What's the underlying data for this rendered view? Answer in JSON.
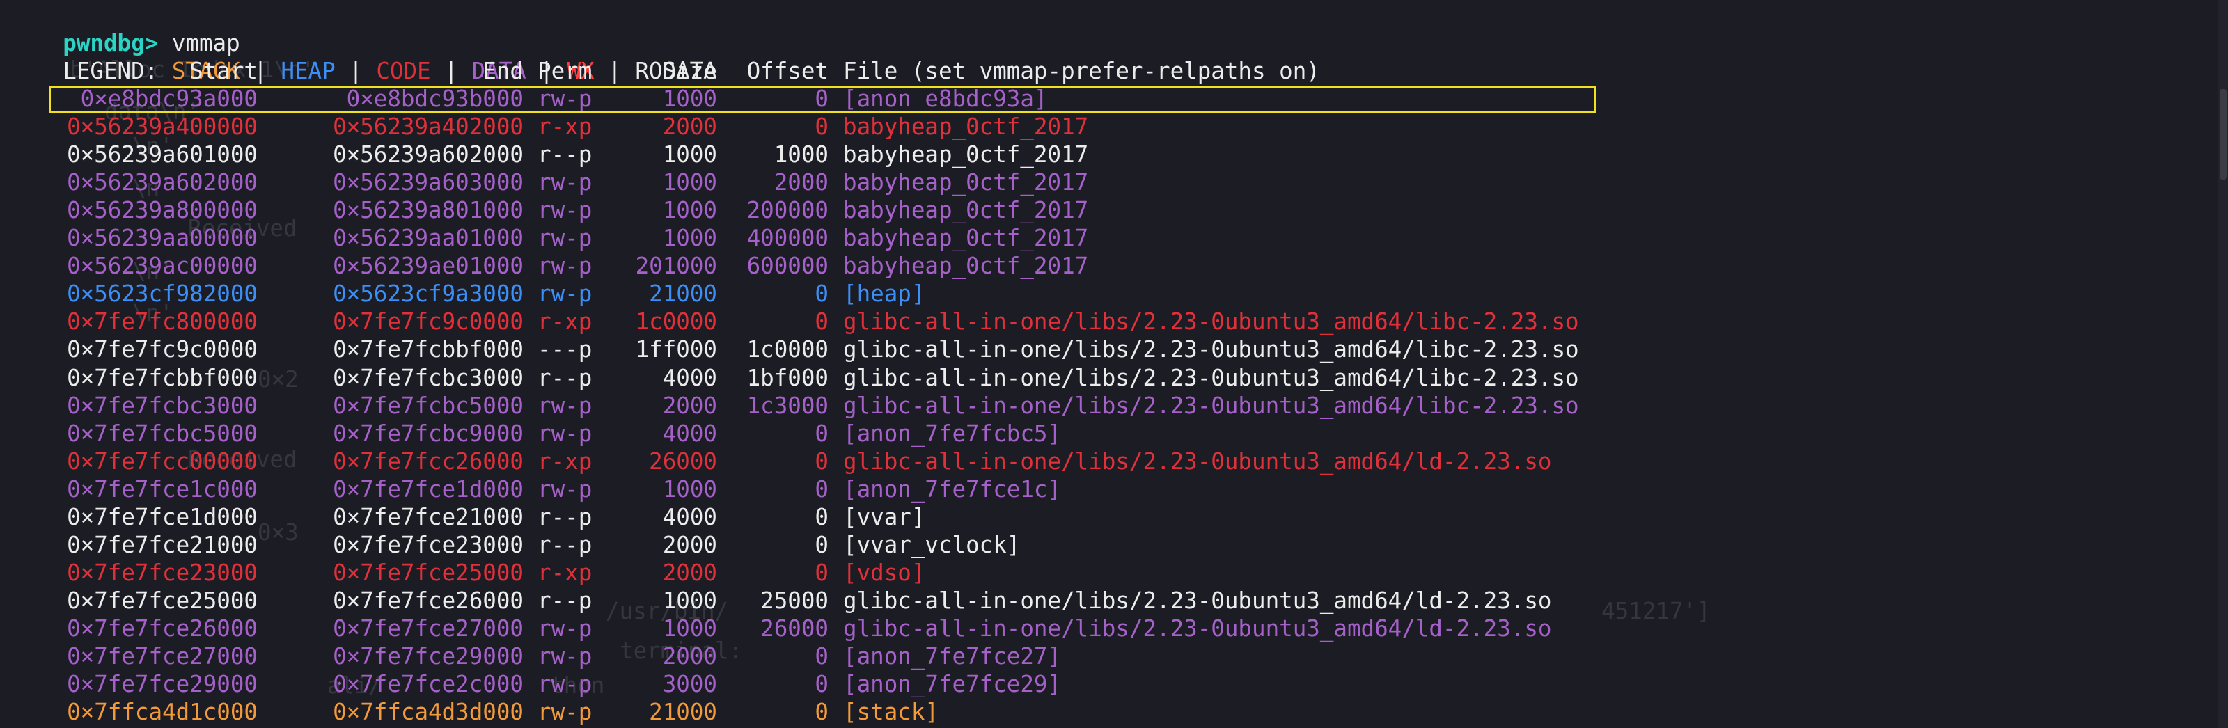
{
  "prompt": {
    "label": "pwndbg>",
    "command": "vmmap"
  },
  "legend": {
    "label": "LEGEND:",
    "separator": "|",
    "items": [
      {
        "text": "STACK",
        "color": "#f39a3a"
      },
      {
        "text": "HEAP",
        "color": "#3b8ff6"
      },
      {
        "text": "CODE",
        "color": "#e0303a"
      },
      {
        "text": "DATA",
        "color": "#a561c9"
      },
      {
        "text": "WX",
        "color": "#ff3d3d"
      },
      {
        "text": "RODATA",
        "color": "#ececec"
      }
    ]
  },
  "table": {
    "headers": {
      "start": "Start",
      "end": "End",
      "perm": "Perm",
      "size": "Size",
      "offset": "Offset",
      "file": "File (set vmmap-prefer-relpaths on)"
    },
    "rows": [
      {
        "start": "0×e8bdc93a000",
        "end": "0×e8bdc93b000",
        "perm": "rw-p",
        "size": "1000",
        "offset": "0",
        "file": "[anon_e8bdc93a]",
        "kind": "data",
        "highlighted": true
      },
      {
        "start": "0×56239a400000",
        "end": "0×56239a402000",
        "perm": "r-xp",
        "size": "2000",
        "offset": "0",
        "file": "babyheap_0ctf_2017",
        "kind": "code"
      },
      {
        "start": "0×56239a601000",
        "end": "0×56239a602000",
        "perm": "r--p",
        "size": "1000",
        "offset": "1000",
        "file": "babyheap_0ctf_2017",
        "kind": "rodata"
      },
      {
        "start": "0×56239a602000",
        "end": "0×56239a603000",
        "perm": "rw-p",
        "size": "1000",
        "offset": "2000",
        "file": "babyheap_0ctf_2017",
        "kind": "data"
      },
      {
        "start": "0×56239a800000",
        "end": "0×56239a801000",
        "perm": "rw-p",
        "size": "1000",
        "offset": "200000",
        "file": "babyheap_0ctf_2017",
        "kind": "data"
      },
      {
        "start": "0×56239aa00000",
        "end": "0×56239aa01000",
        "perm": "rw-p",
        "size": "1000",
        "offset": "400000",
        "file": "babyheap_0ctf_2017",
        "kind": "data"
      },
      {
        "start": "0×56239ac00000",
        "end": "0×56239ae01000",
        "perm": "rw-p",
        "size": "201000",
        "offset": "600000",
        "file": "babyheap_0ctf_2017",
        "kind": "data"
      },
      {
        "start": "0×5623cf982000",
        "end": "0×5623cf9a3000",
        "perm": "rw-p",
        "size": "21000",
        "offset": "0",
        "file": "[heap]",
        "kind": "heap"
      },
      {
        "start": "0×7fe7fc800000",
        "end": "0×7fe7fc9c0000",
        "perm": "r-xp",
        "size": "1c0000",
        "offset": "0",
        "file": "glibc-all-in-one/libs/2.23-0ubuntu3_amd64/libc-2.23.so",
        "kind": "code"
      },
      {
        "start": "0×7fe7fc9c0000",
        "end": "0×7fe7fcbbf000",
        "perm": "---p",
        "size": "1ff000",
        "offset": "1c0000",
        "file": "glibc-all-in-one/libs/2.23-0ubuntu3_amd64/libc-2.23.so",
        "kind": "rodata"
      },
      {
        "start": "0×7fe7fcbbf000",
        "end": "0×7fe7fcbc3000",
        "perm": "r--p",
        "size": "4000",
        "offset": "1bf000",
        "file": "glibc-all-in-one/libs/2.23-0ubuntu3_amd64/libc-2.23.so",
        "kind": "rodata"
      },
      {
        "start": "0×7fe7fcbc3000",
        "end": "0×7fe7fcbc5000",
        "perm": "rw-p",
        "size": "2000",
        "offset": "1c3000",
        "file": "glibc-all-in-one/libs/2.23-0ubuntu3_amd64/libc-2.23.so",
        "kind": "data"
      },
      {
        "start": "0×7fe7fcbc5000",
        "end": "0×7fe7fcbc9000",
        "perm": "rw-p",
        "size": "4000",
        "offset": "0",
        "file": "[anon_7fe7fcbc5]",
        "kind": "data"
      },
      {
        "start": "0×7fe7fcc00000",
        "end": "0×7fe7fcc26000",
        "perm": "r-xp",
        "size": "26000",
        "offset": "0",
        "file": "glibc-all-in-one/libs/2.23-0ubuntu3_amd64/ld-2.23.so",
        "kind": "code"
      },
      {
        "start": "0×7fe7fce1c000",
        "end": "0×7fe7fce1d000",
        "perm": "rw-p",
        "size": "1000",
        "offset": "0",
        "file": "[anon_7fe7fce1c]",
        "kind": "data"
      },
      {
        "start": "0×7fe7fce1d000",
        "end": "0×7fe7fce21000",
        "perm": "r--p",
        "size": "4000",
        "offset": "0",
        "file": "[vvar]",
        "kind": "rodata"
      },
      {
        "start": "0×7fe7fce21000",
        "end": "0×7fe7fce23000",
        "perm": "r--p",
        "size": "2000",
        "offset": "0",
        "file": "[vvar_vclock]",
        "kind": "rodata"
      },
      {
        "start": "0×7fe7fce23000",
        "end": "0×7fe7fce25000",
        "perm": "r-xp",
        "size": "2000",
        "offset": "0",
        "file": "[vdso]",
        "kind": "code"
      },
      {
        "start": "0×7fe7fce25000",
        "end": "0×7fe7fce26000",
        "perm": "r--p",
        "size": "1000",
        "offset": "25000",
        "file": "glibc-all-in-one/libs/2.23-0ubuntu3_amd64/ld-2.23.so",
        "kind": "rodata"
      },
      {
        "start": "0×7fe7fce26000",
        "end": "0×7fe7fce27000",
        "perm": "rw-p",
        "size": "1000",
        "offset": "26000",
        "file": "glibc-all-in-one/libs/2.23-0ubuntu3_amd64/ld-2.23.so",
        "kind": "data"
      },
      {
        "start": "0×7fe7fce27000",
        "end": "0×7fe7fce29000",
        "perm": "rw-p",
        "size": "2000",
        "offset": "0",
        "file": "[anon_7fe7fce27]",
        "kind": "data"
      },
      {
        "start": "0×7fe7fce29000",
        "end": "0×7fe7fce2c000",
        "perm": "rw-p",
        "size": "3000",
        "offset": "0",
        "file": "[anon_7fe7fce29]",
        "kind": "data"
      },
      {
        "start": "0×7ffca4d1c000",
        "end": "0×7ffca4d3d000",
        "perm": "rw-p",
        "size": "21000",
        "offset": "0",
        "file": "[stack]",
        "kind": "stack"
      }
    ]
  },
  "kind_colors": {
    "stack": "#f39a3a",
    "heap": "#3b8ff6",
    "code": "#e0303a",
    "data": "#a561c9",
    "wx": "#ff3d3d",
    "rodata": "#ececec"
  },
  "background_text": [
    {
      "text": "b'Alloc Index 1\\n'"
    },
    {
      "text": "data\\n'"
    },
    {
      "text": "\\n'"
    },
    {
      "text": "\\n'"
    },
    {
      "text": "Received"
    },
    {
      "text": "\\n'"
    },
    {
      "text": "\\n'"
    },
    {
      "text": "0×2"
    },
    {
      "text": "Received"
    },
    {
      "text": "0×3"
    },
    {
      "text": "/usr/bin/"
    },
    {
      "text": "451217']"
    },
    {
      "text": "terminal:"
    },
    {
      "text": "ali/"
    },
    {
      "text": "thon"
    }
  ]
}
